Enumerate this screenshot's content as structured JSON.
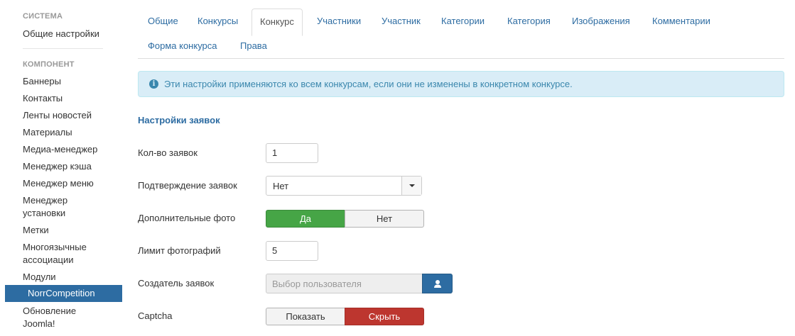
{
  "sidebar": {
    "section_system": "Система",
    "system_items": [
      "Общие настройки"
    ],
    "section_component": "Компонент",
    "component_items": [
      "Баннеры",
      "Контакты",
      "Ленты новостей",
      "Материалы",
      "Медиа-менеджер",
      "Менеджер кэша",
      "Менеджер меню",
      "Менеджер установки",
      "Метки",
      "Многоязычные ассоциации",
      "Модули",
      "NorrCompetition",
      "Обновление Joomla!"
    ],
    "active_item": "NorrCompetition"
  },
  "tabs": [
    {
      "label": "Общие",
      "active": false
    },
    {
      "label": "Конкурсы",
      "active": false
    },
    {
      "label": "Конкурс",
      "active": true
    },
    {
      "label": "Участники",
      "active": false
    },
    {
      "label": "Участник",
      "active": false
    },
    {
      "label": "Категории",
      "active": false
    },
    {
      "label": "Категория",
      "active": false
    },
    {
      "label": "Изображения",
      "active": false
    },
    {
      "label": "Комментарии",
      "active": false
    },
    {
      "label": "Форма конкурса",
      "active": false
    },
    {
      "label": "Права",
      "active": false
    }
  ],
  "alert": {
    "icon": "info-icon",
    "text": "Эти настройки применяются ко всем конкурсам, если они не изменены в конкретном конкурсе."
  },
  "section_title": "Настройки заявок",
  "form": {
    "entries_count": {
      "label": "Кол-во заявок",
      "value": "1"
    },
    "confirmation": {
      "label": "Подтверждение заявок",
      "value": "Нет"
    },
    "extra_photos": {
      "label": "Дополнительные фото",
      "yes": "Да",
      "no": "Нет",
      "selected": "Да"
    },
    "photo_limit": {
      "label": "Лимит фотографий",
      "value": "5"
    },
    "creator": {
      "label": "Создатель заявок",
      "placeholder": "Выбор пользователя",
      "button_icon": "user-icon"
    },
    "captcha": {
      "label": "Captcha",
      "show": "Показать",
      "hide": "Скрыть",
      "selected": "Скрыть"
    }
  },
  "colors": {
    "accent": "#2d6ca2",
    "success": "#46a546",
    "danger": "#bd362f",
    "info_bg": "#d9edf7",
    "info_text": "#3a87ad"
  }
}
